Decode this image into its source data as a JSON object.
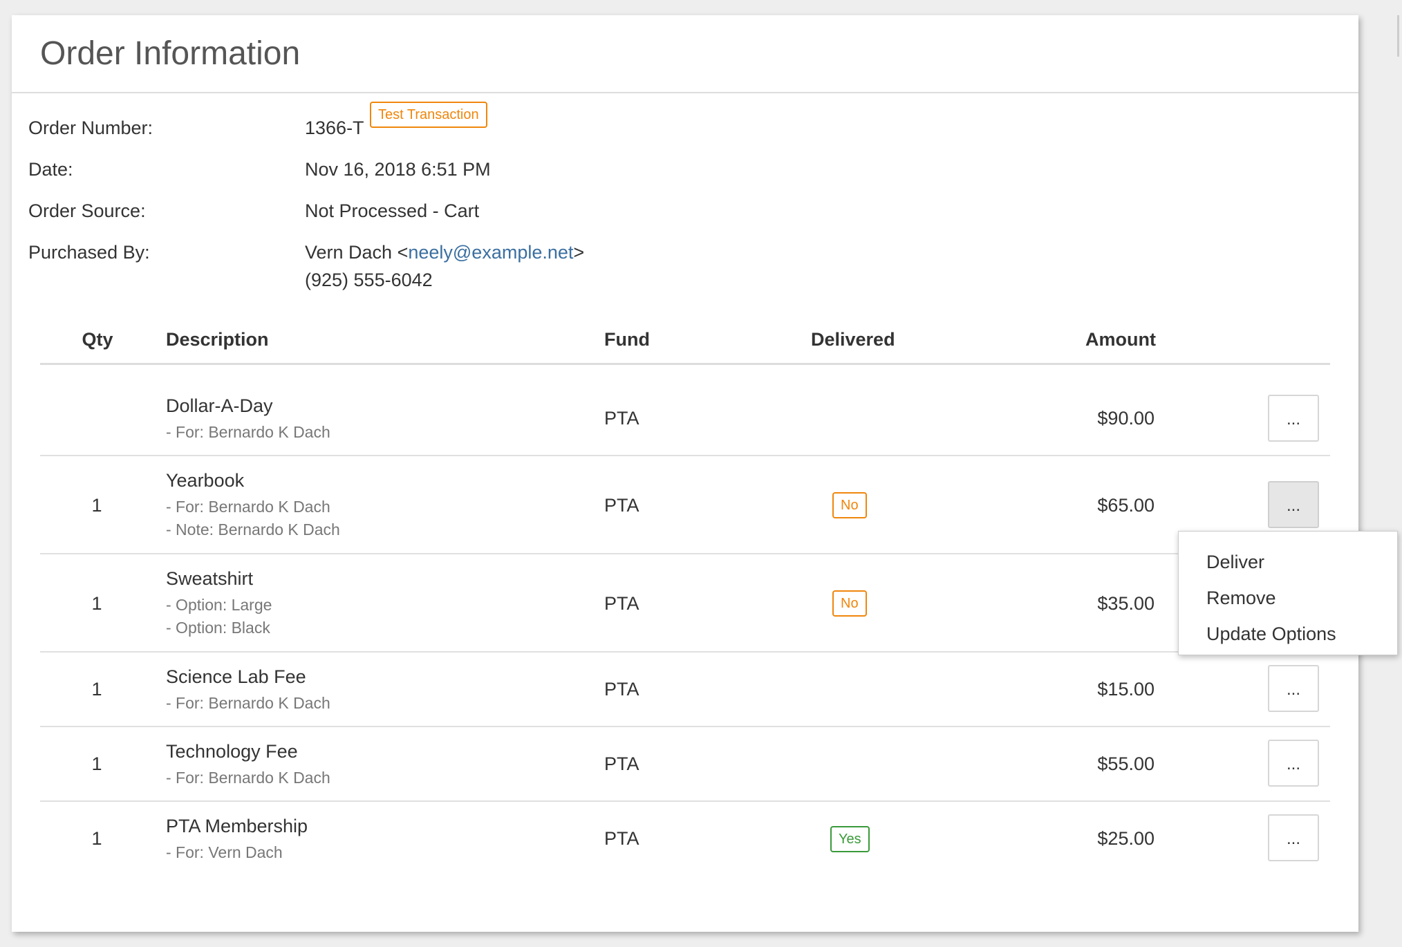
{
  "title": "Order Information",
  "info": {
    "order_number_label": "Order Number:",
    "order_number": "1366-T",
    "test_badge": "Test Transaction",
    "date_label": "Date:",
    "date": "Nov 16, 2018 6:51 PM",
    "source_label": "Order Source:",
    "source": "Not Processed - Cart",
    "purchased_label": "Purchased By:",
    "purchaser_name": "Vern Dach <",
    "purchaser_email": "neely@example.net",
    "purchaser_close": ">",
    "purchaser_phone": "(925) 555-6042"
  },
  "table": {
    "headers": {
      "qty": "Qty",
      "description": "Description",
      "fund": "Fund",
      "delivered": "Delivered",
      "amount": "Amount"
    },
    "rows": [
      {
        "qty": "",
        "title": "Dollar-A-Day",
        "sub1": "- For: Bernardo K Dach",
        "sub2": "",
        "fund": "PTA",
        "delivered": "",
        "amount": "$90.00",
        "more": "..."
      },
      {
        "qty": "1",
        "title": "Yearbook",
        "sub1": "- For: Bernardo K Dach",
        "sub2": "- Note: Bernardo K Dach",
        "fund": "PTA",
        "delivered": "No",
        "amount": "$65.00",
        "more": "..."
      },
      {
        "qty": "1",
        "title": "Sweatshirt",
        "sub1": "- Option: Large",
        "sub2": "- Option: Black",
        "fund": "PTA",
        "delivered": "No",
        "amount": "$35.00",
        "more": "..."
      },
      {
        "qty": "1",
        "title": "Science Lab Fee",
        "sub1": "- For: Bernardo K Dach",
        "sub2": "",
        "fund": "PTA",
        "delivered": "",
        "amount": "$15.00",
        "more": "..."
      },
      {
        "qty": "1",
        "title": "Technology Fee",
        "sub1": "- For: Bernardo K Dach",
        "sub2": "",
        "fund": "PTA",
        "delivered": "",
        "amount": "$55.00",
        "more": "..."
      },
      {
        "qty": "1",
        "title": "PTA Membership",
        "sub1": "- For: Vern Dach",
        "sub2": "",
        "fund": "PTA",
        "delivered": "Yes",
        "amount": "$25.00",
        "more": "..."
      }
    ]
  },
  "dropdown": {
    "items": [
      "Deliver",
      "Remove",
      "Update Options"
    ]
  },
  "colors": {
    "warning": "#f0860c",
    "success": "#3a9a3a",
    "link": "#3b6fa0"
  }
}
